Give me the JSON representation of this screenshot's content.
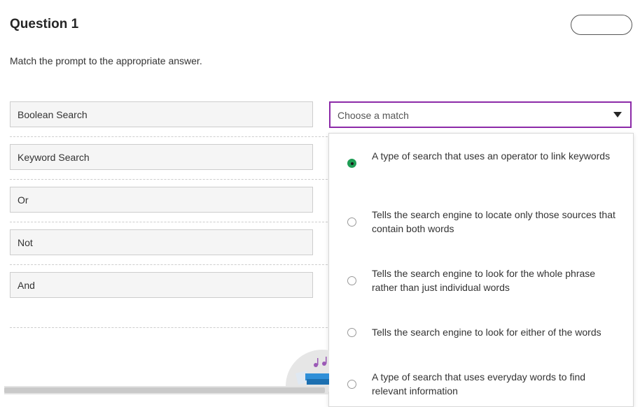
{
  "question": {
    "title": "Question 1",
    "instructions": "Match the prompt to the appropriate answer."
  },
  "prompts": [
    "Boolean Search",
    "Keyword Search",
    "Or",
    "Not",
    "And"
  ],
  "select": {
    "placeholder": "Choose a match"
  },
  "options": [
    {
      "text": "A type of search that uses an operator to link keywords",
      "selected": true
    },
    {
      "text": "Tells the search engine to locate only those sources that contain both words",
      "selected": false
    },
    {
      "text": "Tells the search engine to look for the whole phrase rather than just individual words",
      "selected": false
    },
    {
      "text": "Tells the search engine to look for either of the words",
      "selected": false
    },
    {
      "text": "A type of search that uses everyday words to find relevant information",
      "selected": false
    }
  ],
  "colors": {
    "accent_border": "#8c2aa8",
    "selected_radio": "#1f9d55"
  }
}
